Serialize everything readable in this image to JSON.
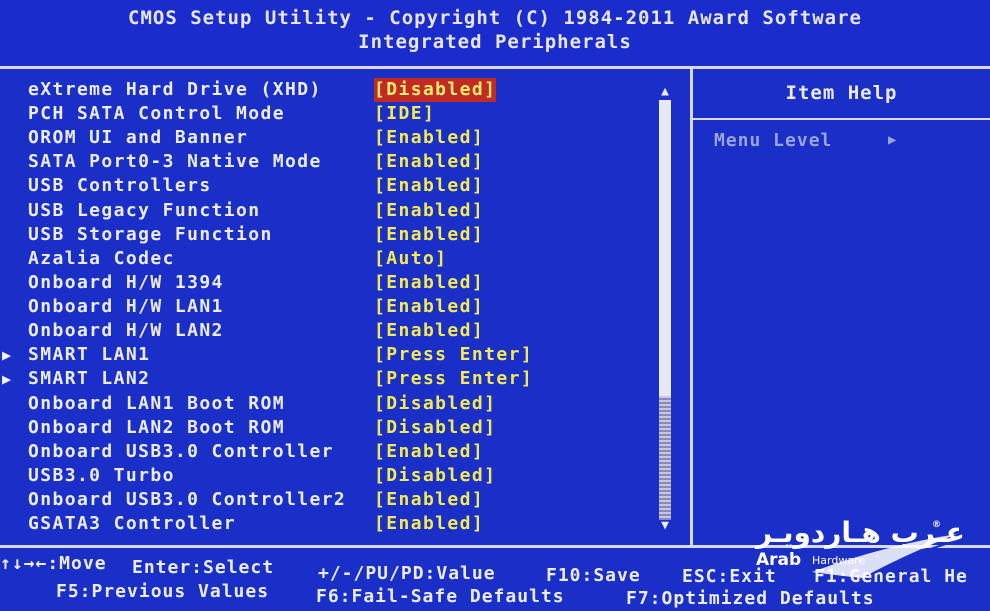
{
  "header": {
    "line1": "CMOS Setup Utility - Copyright (C) 1984-2011 Award Software",
    "line2": "Integrated Peripherals"
  },
  "menu": {
    "items": [
      {
        "name": "eXtreme Hard Drive (XHD)",
        "value": "[Disabled]",
        "selected": true,
        "submenu": false
      },
      {
        "name": "PCH SATA Control Mode",
        "value": "[IDE]",
        "selected": false,
        "submenu": false
      },
      {
        "name": "OROM UI and Banner",
        "value": "[Enabled]",
        "selected": false,
        "submenu": false
      },
      {
        "name": "SATA Port0-3 Native Mode",
        "value": "[Enabled]",
        "selected": false,
        "submenu": false
      },
      {
        "name": "USB Controllers",
        "value": "[Enabled]",
        "selected": false,
        "submenu": false
      },
      {
        "name": "USB Legacy Function",
        "value": "[Enabled]",
        "selected": false,
        "submenu": false
      },
      {
        "name": "USB Storage Function",
        "value": "[Enabled]",
        "selected": false,
        "submenu": false
      },
      {
        "name": "Azalia Codec",
        "value": "[Auto]",
        "selected": false,
        "submenu": false
      },
      {
        "name": "Onboard H/W 1394",
        "value": "[Enabled]",
        "selected": false,
        "submenu": false
      },
      {
        "name": "Onboard H/W LAN1",
        "value": "[Enabled]",
        "selected": false,
        "submenu": false
      },
      {
        "name": "Onboard H/W LAN2",
        "value": "[Enabled]",
        "selected": false,
        "submenu": false
      },
      {
        "name": "SMART LAN1",
        "value": "[Press Enter]",
        "selected": false,
        "submenu": true
      },
      {
        "name": "SMART LAN2",
        "value": "[Press Enter]",
        "selected": false,
        "submenu": true
      },
      {
        "name": "Onboard LAN1 Boot ROM",
        "value": "[Disabled]",
        "selected": false,
        "submenu": false
      },
      {
        "name": "Onboard LAN2 Boot ROM",
        "value": "[Disabled]",
        "selected": false,
        "submenu": false
      },
      {
        "name": "Onboard USB3.0 Controller",
        "value": "[Enabled]",
        "selected": false,
        "submenu": false
      },
      {
        "name": "USB3.0 Turbo",
        "value": "[Disabled]",
        "selected": false,
        "submenu": false
      },
      {
        "name": "Onboard USB3.0 Controller2",
        "value": "[Enabled]",
        "selected": false,
        "submenu": false
      },
      {
        "name": "GSATA3 Controller",
        "value": "[Enabled]",
        "selected": false,
        "submenu": false
      }
    ],
    "submenu_arrow": "▶",
    "scroll_up": "▲",
    "scroll_down": "▼"
  },
  "help": {
    "title": "Item Help",
    "menu_level": "Menu Level",
    "menu_level_arrow": "▶"
  },
  "footer": {
    "move": "↑↓→←:Move",
    "enter": "Enter:Select",
    "value": "+/-/PU/PD:Value",
    "save": "F10:Save",
    "exit": "ESC:Exit",
    "help": "F1:General He",
    "prev": "F5:Previous Values",
    "failsafe": "F6:Fail-Safe Defaults",
    "optimized": "F7:Optimized Defaults"
  },
  "watermark": {
    "arabic": "عـرب هـاردويـر",
    "latin": "Arab",
    "latin_small": "Hardware",
    "reg": "®"
  },
  "colors": {
    "background": "#1a2fc8",
    "value_text": "#f2ea55",
    "selected_bg": "#c42a24",
    "dim_text": "#9ba3d9"
  }
}
